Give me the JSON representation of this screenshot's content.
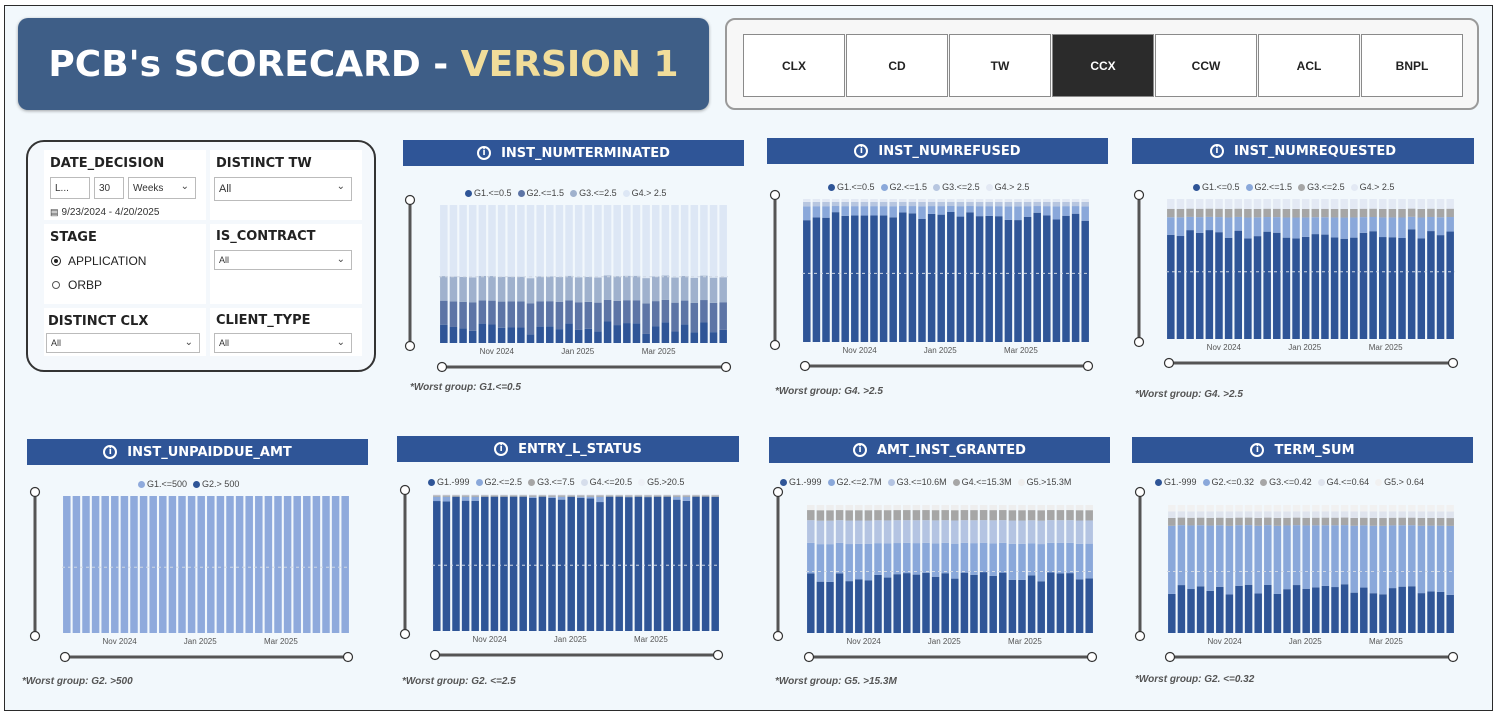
{
  "title": {
    "main": "PCB's SCORECARD - ",
    "version": "VERSION 1"
  },
  "nav": {
    "buttons": [
      "CLX",
      "CD",
      "TW",
      "CCX",
      "CCW",
      "ACL",
      "BNPL"
    ],
    "active": "CCX"
  },
  "filters": {
    "date_decision": {
      "label": "DATE_DECISION",
      "mode": "L...",
      "count": "30",
      "unit": "Weeks",
      "range": "9/23/2024 - 4/20/2025"
    },
    "distinct_tw": {
      "label": "DISTINCT TW",
      "value": "All"
    },
    "stage": {
      "label": "STAGE",
      "options": [
        "APPLICATION",
        "ORBP"
      ],
      "selected": "APPLICATION"
    },
    "is_contract": {
      "label": "IS_CONTRACT",
      "value": "All"
    },
    "distinct_clx": {
      "label": "DISTINCT CLX",
      "value": "All"
    },
    "client_type": {
      "label": "CLIENT_TYPE",
      "value": "All"
    }
  },
  "chart_data": [
    {
      "type": "bar",
      "title": "INST_NUMTERMINATED",
      "series": [
        {
          "name": "G1.<=0.5",
          "color": "#2f5597"
        },
        {
          "name": "G2.<=1.5",
          "color": "#5d75a6"
        },
        {
          "name": "G3.<=2.5",
          "color": "#9fb1cd"
        },
        {
          "name": "G4.> 2.5",
          "color": "#dde7f5"
        }
      ],
      "x_ticks": [
        "Nov 2024",
        "Jan 2025",
        "Mar 2025"
      ],
      "bars": 30,
      "stack_fractions": [
        0.11,
        0.19,
        0.18,
        0.52
      ],
      "worst": "*Worst group: G1.<=0.5"
    },
    {
      "type": "bar",
      "title": "INST_NUMREFUSED",
      "series": [
        {
          "name": "G1.<=0.5",
          "color": "#2f5597"
        },
        {
          "name": "G2.<=1.5",
          "color": "#8aa8da"
        },
        {
          "name": "G3.<=2.5",
          "color": "#b7c6e0"
        },
        {
          "name": "G4.> 2.5",
          "color": "#e3e9f4"
        }
      ],
      "x_ticks": [
        "Nov 2024",
        "Jan 2025",
        "Mar 2025"
      ],
      "bars": 30,
      "stack_fractions": [
        0.88,
        0.07,
        0.03,
        0.02
      ],
      "worst": "*Worst group: G4. >2.5"
    },
    {
      "type": "bar",
      "title": "INST_NUMREQUESTED",
      "series": [
        {
          "name": "G1.<=0.5",
          "color": "#2f5597"
        },
        {
          "name": "G2.<=1.5",
          "color": "#8aa8da"
        },
        {
          "name": "G3.<=2.5",
          "color": "#a6a6a6"
        },
        {
          "name": "G4.> 2.5",
          "color": "#e3e9f4"
        }
      ],
      "x_ticks": [
        "Nov 2024",
        "Jan 2025",
        "Mar 2025"
      ],
      "bars": 30,
      "stack_fractions": [
        0.75,
        0.12,
        0.06,
        0.07
      ],
      "worst": "*Worst group: G4. >2.5"
    },
    {
      "type": "bar",
      "title": "INST_UNPAIDDUE_AMT",
      "series": [
        {
          "name": "G1.<=500",
          "color": "#8faadc"
        },
        {
          "name": "G2.> 500",
          "color": "#2f5597"
        }
      ],
      "x_ticks": [
        "Nov 2024",
        "Jan 2025",
        "Mar 2025"
      ],
      "bars": 30,
      "stack_fractions": [
        1.0,
        0.0
      ],
      "worst": "*Worst group: G2. >500"
    },
    {
      "type": "bar",
      "title": "ENTRY_L_STATUS",
      "series": [
        {
          "name": "G1.-999",
          "color": "#2f5597"
        },
        {
          "name": "G2.<=2.5",
          "color": "#8aa8da"
        },
        {
          "name": "G3.<=7.5",
          "color": "#a6a6a6"
        },
        {
          "name": "G4.<=20.5",
          "color": "#d6deec"
        },
        {
          "name": "G5.>20.5",
          "color": "#eef1f7"
        }
      ],
      "x_ticks": [
        "Nov 2024",
        "Jan 2025",
        "Mar 2025"
      ],
      "bars": 30,
      "stack_fractions": [
        0.97,
        0.01,
        0.01,
        0.005,
        0.005
      ],
      "worst": "*Worst group: G2. <=2.5"
    },
    {
      "type": "bar",
      "title": "AMT_INST_GRANTED",
      "series": [
        {
          "name": "G1.-999",
          "color": "#2f5597"
        },
        {
          "name": "G2.<=2.7M",
          "color": "#8aa8da"
        },
        {
          "name": "G3.<=10.6M",
          "color": "#b4c4e2"
        },
        {
          "name": "G4.<=15.3M",
          "color": "#a6a6a6"
        },
        {
          "name": "G5.>15.3M",
          "color": "#eeeeee"
        }
      ],
      "x_ticks": [
        "Nov 2024",
        "Jan 2025",
        "Mar 2025"
      ],
      "bars": 30,
      "stack_fractions": [
        0.44,
        0.26,
        0.18,
        0.08,
        0.04
      ],
      "worst": "*Worst group: G5. >15.3M"
    },
    {
      "type": "bar",
      "title": "TERM_SUM",
      "series": [
        {
          "name": "G1.-999",
          "color": "#2f5597"
        },
        {
          "name": "G2.<=0.32",
          "color": "#8aa8da"
        },
        {
          "name": "G3.<=0.42",
          "color": "#a6a6a6"
        },
        {
          "name": "G4.<=0.64",
          "color": "#dfe4ee"
        },
        {
          "name": "G5.> 0.64",
          "color": "#f1f1f1"
        }
      ],
      "x_ticks": [
        "Nov 2024",
        "Jan 2025",
        "Mar 2025"
      ],
      "bars": 30,
      "stack_fractions": [
        0.34,
        0.5,
        0.06,
        0.05,
        0.05
      ],
      "worst": "*Worst group: G2. <=0.32"
    }
  ]
}
